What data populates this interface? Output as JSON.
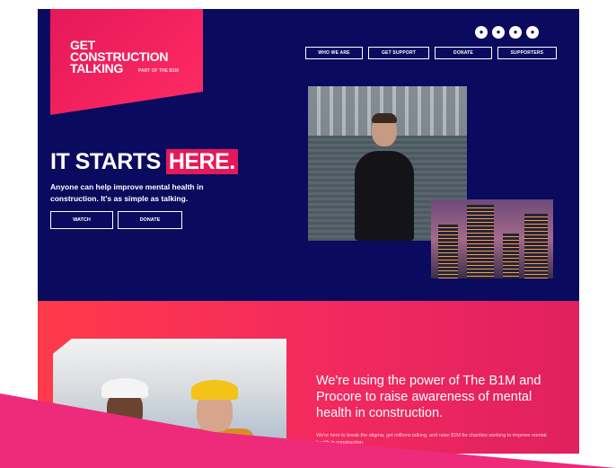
{
  "logo": {
    "text": "GET\nCONSTRUCTION\nTALKING",
    "tagline": "PART OF THE B1M"
  },
  "socials": [
    {
      "icon": "instagram-icon",
      "glyph": "●"
    },
    {
      "icon": "twitter-icon",
      "glyph": "●"
    },
    {
      "icon": "facebook-icon",
      "glyph": "●"
    },
    {
      "icon": "globe-icon",
      "glyph": "●"
    }
  ],
  "nav": [
    "WHO WE ARE",
    "GET SUPPORT",
    "DONATE",
    "SUPPORTERS"
  ],
  "hero": {
    "headline_start": "IT STARTS",
    "headline_highlight": "HERE.",
    "subtext": "Anyone can help improve mental health in construction. It's as simple as talking.",
    "watch_label": "WATCH",
    "donate_label": "DONATE"
  },
  "mission": {
    "heading": "We're using the power of The B1M and Procore to raise awareness of mental health in construction.",
    "body": "We're here to break the stigma, get millions talking, and raise $1M for charities working to improve mental health in construction."
  },
  "colors": {
    "navy": "#0a0a5e",
    "pink": "#e6185a",
    "coral": "#ff3a4a"
  }
}
